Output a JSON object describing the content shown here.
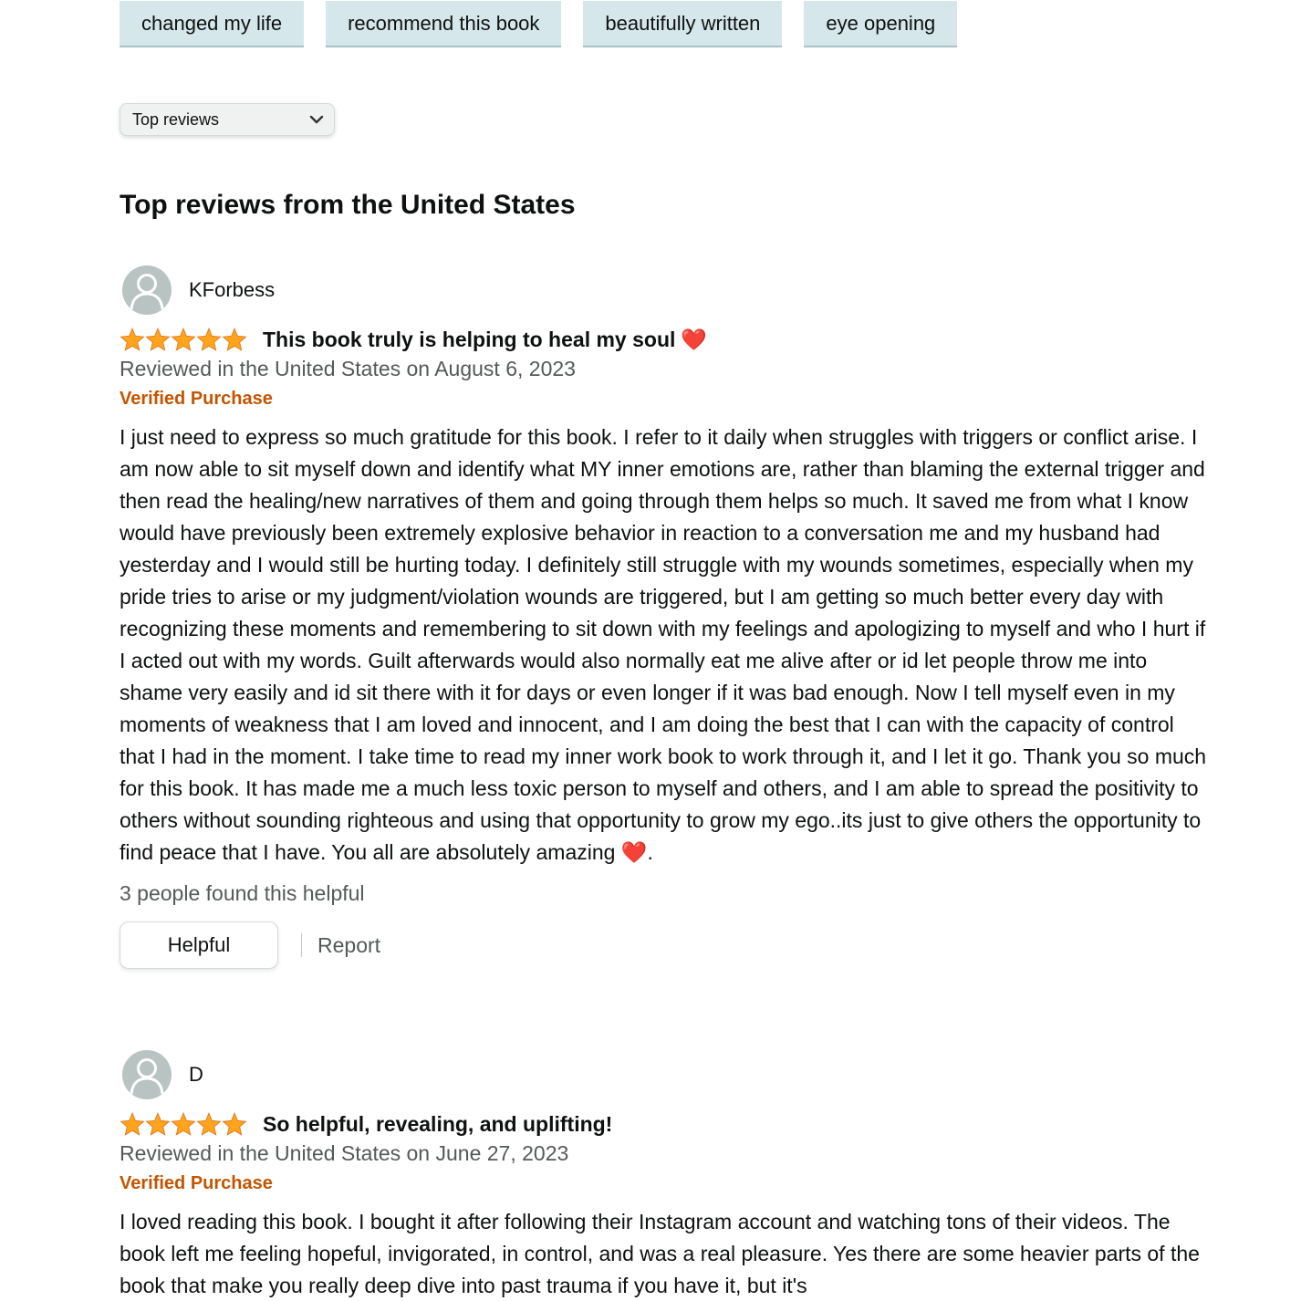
{
  "tags": [
    "changed my life",
    "recommend this book",
    "beautifully written",
    "eye opening"
  ],
  "sort": {
    "selected": "Top reviews",
    "icon": "chevron-down-icon"
  },
  "section_title": "Top reviews from the United States",
  "colors": {
    "tag_bg": "#d5e7ea",
    "star": "#ffa41c",
    "verified": "#c45500",
    "muted_text": "#565959"
  },
  "reviews": [
    {
      "profile_name": "KForbess",
      "rating": 5,
      "title": "This book truly is helping to heal my soul",
      "title_emoji": "❤️",
      "date": "Reviewed in the United States on August 6, 2023",
      "verified": "Verified Purchase",
      "body": "I just need to express so much gratitude for this book. I refer to it daily when struggles with triggers or conflict arise. I am now able to sit myself down and identify what MY inner emotions are, rather than blaming the external trigger and then read the healing/new narratives of them and going through them helps so much. It saved me from what I know would have previously been extremely explosive behavior in reaction to a conversation me and my husband had yesterday and I would still be hurting today. I definitely still struggle with my wounds sometimes, especially when my pride tries to arise or my judgment/violation wounds are triggered, but I am getting so much better every day with recognizing these moments and remembering to sit down with my feelings and apologizing to myself and who I hurt if I acted out with my words. Guilt afterwards would also normally eat me alive after or id let people throw me into shame very easily and id sit there with it for days or even longer if it was bad enough. Now I tell myself even in my moments of weakness that I am loved and innocent, and I am doing the best that I can with the capacity of control that I had in the moment. I take time to read my inner work book to work through it, and I let it go. Thank you so much for this book. It has made me a much less toxic person to myself and others, and I am able to spread the positivity to others without sounding righteous and using that opportunity to grow my ego..its just to give others the opportunity to find peace that I have. You all are absolutely amazing ❤️.",
      "helpful_count": "3 people found this helpful",
      "helpful_label": "Helpful",
      "report_label": "Report"
    },
    {
      "profile_name": "D",
      "rating": 5,
      "title": "So helpful, revealing, and uplifting!",
      "date": "Reviewed in the United States on June 27, 2023",
      "verified": "Verified Purchase",
      "body": "I loved reading this book. I bought it after following their Instagram account and watching tons of their videos. The book left me feeling hopeful, invigorated, in control, and was a real pleasure. Yes there are some heavier parts of the book that make you really deep dive into past trauma if you have it, but it's"
    }
  ]
}
